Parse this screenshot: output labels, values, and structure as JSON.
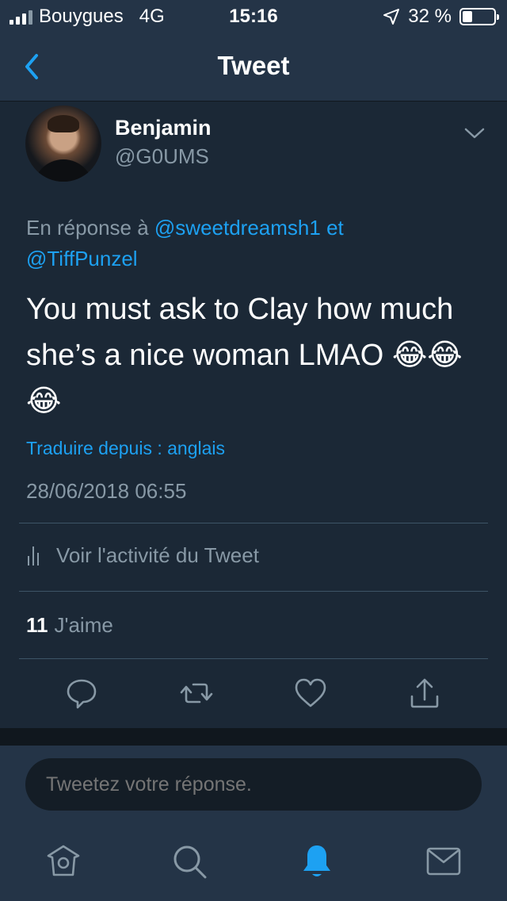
{
  "status_bar": {
    "carrier": "Bouygues",
    "network": "4G",
    "time": "15:16",
    "battery_text": "32 %",
    "battery_level": 0.32
  },
  "navbar": {
    "title": "Tweet",
    "back_icon": "chevron-left-icon"
  },
  "tweet": {
    "author_name": "Benjamin",
    "author_handle": "@G0UMS",
    "reply_prefix": "En réponse à",
    "reply_user_1": "@sweetdreamsh1",
    "reply_conjunction": "et",
    "reply_user_2": "@TiffPunzel",
    "text": "You must ask to Clay how much she’s a nice woman LMAO 😂😂😂",
    "translate_label": "Traduire depuis : anglais",
    "timestamp": "28/06/2018 06:55",
    "activity_label": "Voir l'activité du Tweet",
    "likes_count": "11",
    "likes_label": "J'aime"
  },
  "actions": {
    "icons": [
      "reply-icon",
      "retweet-icon",
      "like-icon",
      "share-icon"
    ]
  },
  "reply_bar": {
    "placeholder": "Tweetez votre réponse."
  },
  "tabbar": {
    "icons": [
      "home-icon",
      "search-icon",
      "notifications-icon",
      "messages-icon"
    ],
    "active": "notifications-icon"
  },
  "colors": {
    "background": "#1b2836",
    "bar_background": "#243447",
    "accent": "#1da1f2",
    "secondary_text": "#8899a6"
  }
}
